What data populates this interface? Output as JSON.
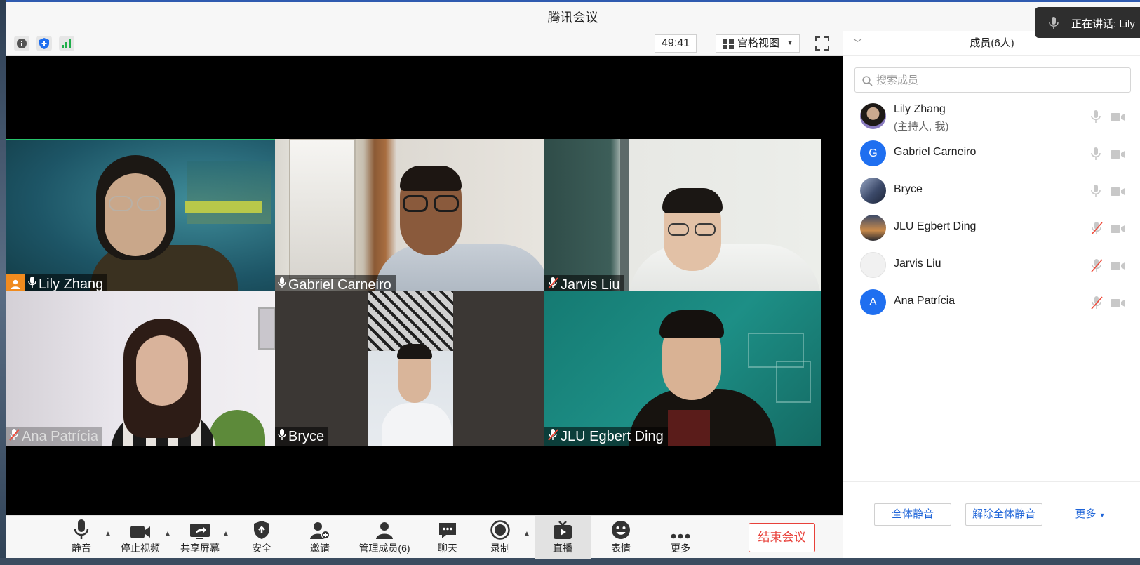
{
  "window": {
    "title": "腾讯会议"
  },
  "speaking_indicator": "正在讲话: Lily",
  "toolbar": {
    "timer": "49:41",
    "view_mode": "宫格视图"
  },
  "tiles": [
    {
      "name": "Lily Zhang",
      "mic": "on",
      "host": true
    },
    {
      "name": "Gabriel Carneiro",
      "mic": "on"
    },
    {
      "name": "Jarvis Liu",
      "mic": "muted"
    },
    {
      "name": "Ana Patrícia",
      "mic": "muted"
    },
    {
      "name": "Bryce",
      "mic": "on"
    },
    {
      "name": "JLU Egbert Ding",
      "mic": "muted"
    }
  ],
  "bottombar": {
    "mute": "静音",
    "stop_video": "停止视频",
    "share_screen": "共享屏幕",
    "security": "安全",
    "invite": "邀请",
    "manage_members": "管理成员(6)",
    "chat": "聊天",
    "record": "录制",
    "live": "直播",
    "reactions": "表情",
    "more": "更多",
    "end_meeting": "结束会议"
  },
  "panel": {
    "title": "成员(6人)",
    "search_placeholder": "搜索成员",
    "members": [
      {
        "name": "Lily Zhang",
        "sub": "(主持人, 我)",
        "avatar": "photo",
        "mic": "on"
      },
      {
        "name": "Gabriel Carneiro",
        "avatar_letter": "G",
        "avatar_color": "#1f6ff0",
        "mic": "on"
      },
      {
        "name": "Bryce",
        "avatar": "photo",
        "mic": "on"
      },
      {
        "name": "JLU Egbert Ding",
        "avatar": "photo",
        "mic": "muted"
      },
      {
        "name": "Jarvis Liu",
        "avatar": "photo",
        "mic": "muted"
      },
      {
        "name": "Ana Patrícia",
        "avatar_letter": "A",
        "avatar_color": "#1f6ff0",
        "mic": "muted"
      }
    ],
    "footer": {
      "mute_all": "全体静音",
      "unmute_all": "解除全体静音",
      "more": "更多"
    }
  },
  "colors": {
    "accent": "#1e64d8",
    "end": "#e8413a",
    "host_badge": "#f08b1e"
  }
}
